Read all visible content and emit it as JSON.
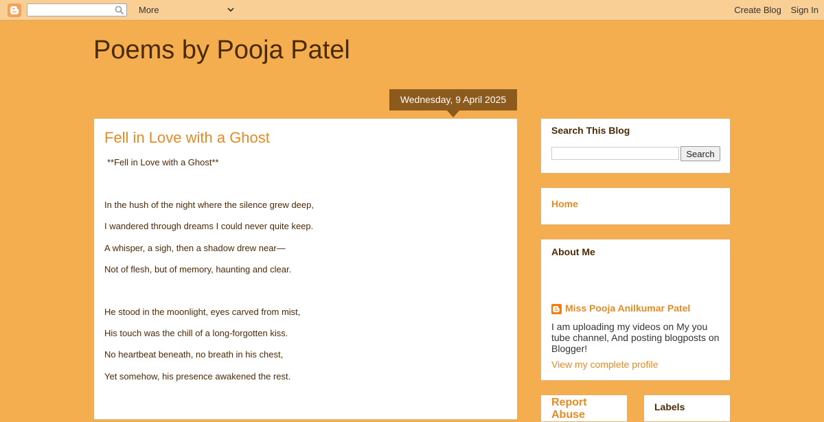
{
  "navbar": {
    "logo_icon": "blogger-logo-icon",
    "search_placeholder": "",
    "more_label": "More",
    "create_blog": "Create Blog",
    "sign_in": "Sign In"
  },
  "blog": {
    "title": "Poems by Pooja Patel"
  },
  "post": {
    "date": "Wednesday, 9 April 2025",
    "title": "Fell in Love with a Ghost",
    "intro": "**Fell in Love with a Ghost**",
    "stanzas": [
      [
        "In the hush of the night where the silence grew deep,",
        "I wandered through dreams I could never quite keep.",
        "A whisper, a sigh, then a shadow drew near—",
        "Not of flesh, but of memory, haunting and clear."
      ],
      [
        "He stood in the moonlight, eyes carved from mist,",
        "His touch was the chill of a long-forgotten kiss.",
        "No heartbeat beneath, no breath in his chest,",
        "Yet somehow, his presence awakened the rest."
      ]
    ]
  },
  "sidebar": {
    "search": {
      "heading": "Search This Blog",
      "button": "Search"
    },
    "pages": {
      "home": "Home"
    },
    "about": {
      "heading": "About Me",
      "name": "Miss Pooja Anilkumar Patel",
      "description": "I am uploading my videos on My you tube channel, And posting blogposts on Blogger!",
      "profile_link": "View my complete profile"
    },
    "report": {
      "heading": "Report Abuse"
    },
    "labels": {
      "heading": "Labels"
    }
  },
  "colors": {
    "background": "#f4ae50",
    "navbar": "#f9cf96",
    "accent": "#e58b24",
    "title": "#4b2a06",
    "date_bg": "#8d5a1d"
  }
}
